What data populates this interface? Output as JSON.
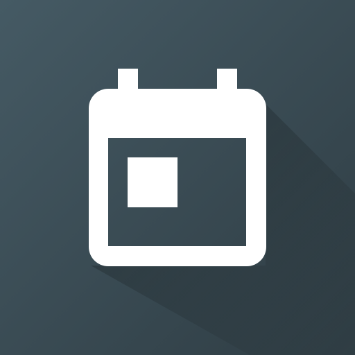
{
  "icon": {
    "name": "calendar-event-icon",
    "background_color": "#37474f",
    "glyph_color": "#ffffff"
  }
}
